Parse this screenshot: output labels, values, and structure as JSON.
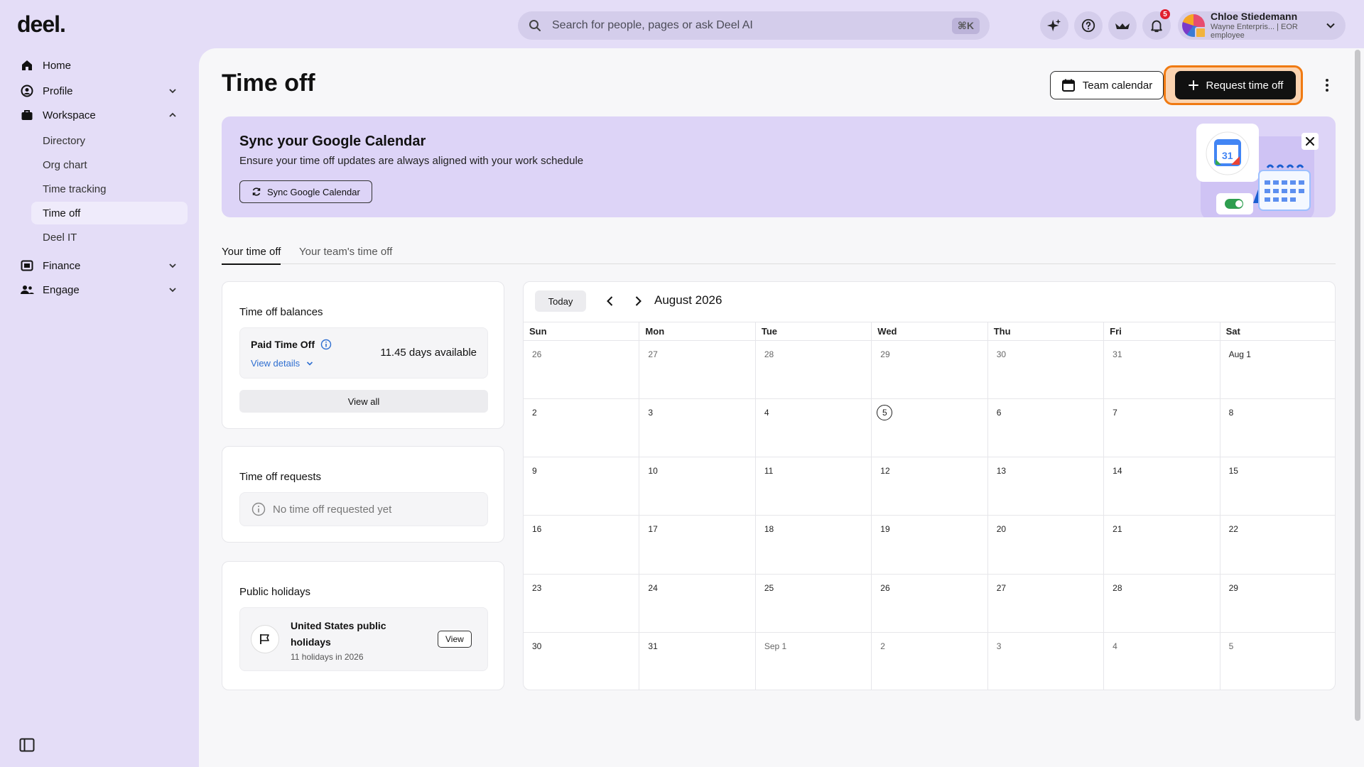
{
  "brand": {
    "logo": "deel."
  },
  "search": {
    "placeholder": "Search for people, pages or ask Deel AI",
    "shortcut": "⌘K"
  },
  "topbar": {
    "notifications_count": "5",
    "user": {
      "name": "Chloe Stiedemann",
      "subtitle": "Wayne Enterpris... | EOR employee"
    }
  },
  "sidebar": {
    "home": "Home",
    "profile": "Profile",
    "workspace": "Workspace",
    "workspace_items": [
      "Directory",
      "Org chart",
      "Time tracking",
      "Time off",
      "Deel IT"
    ],
    "finance": "Finance",
    "engage": "Engage"
  },
  "page": {
    "title": "Time off",
    "team_calendar_label": "Team calendar",
    "request_label": "Request time off"
  },
  "banner": {
    "title": "Sync your Google Calendar",
    "text": "Ensure your time off updates are always aligned with your work schedule",
    "button": "Sync Google Calendar",
    "calendar_icon_day": "31"
  },
  "tabs": [
    "Your time off",
    "Your team's time off"
  ],
  "balances": {
    "title": "Time off balances",
    "policy": "Paid Time Off",
    "details_link": "View details",
    "available": "11.45 days available",
    "view_all": "View all"
  },
  "requests": {
    "title": "Time off requests",
    "empty": "No time off requested yet"
  },
  "holidays": {
    "title": "Public holidays",
    "name": "United States public holidays",
    "count": "11 holidays in 2026",
    "view": "View"
  },
  "calendar": {
    "today_label": "Today",
    "month": "August 2026",
    "weekdays": [
      "Sun",
      "Mon",
      "Tue",
      "Wed",
      "Thu",
      "Fri",
      "Sat"
    ],
    "weeks": [
      [
        "26",
        "27",
        "28",
        "29",
        "30",
        "31",
        "Aug 1"
      ],
      [
        "2",
        "3",
        "4",
        "5",
        "6",
        "7",
        "8"
      ],
      [
        "9",
        "10",
        "11",
        "12",
        "13",
        "14",
        "15"
      ],
      [
        "16",
        "17",
        "18",
        "19",
        "20",
        "21",
        "22"
      ],
      [
        "23",
        "24",
        "25",
        "26",
        "27",
        "28",
        "29"
      ],
      [
        "30",
        "31",
        "Sep 1",
        "2",
        "3",
        "4",
        "5"
      ]
    ],
    "today_date": "5"
  },
  "colors": {
    "accent": "#f07a12",
    "sidebar_bg": "#e4ddf7",
    "banner_bg": "#ddd4f7",
    "link": "#2f6fd1"
  }
}
